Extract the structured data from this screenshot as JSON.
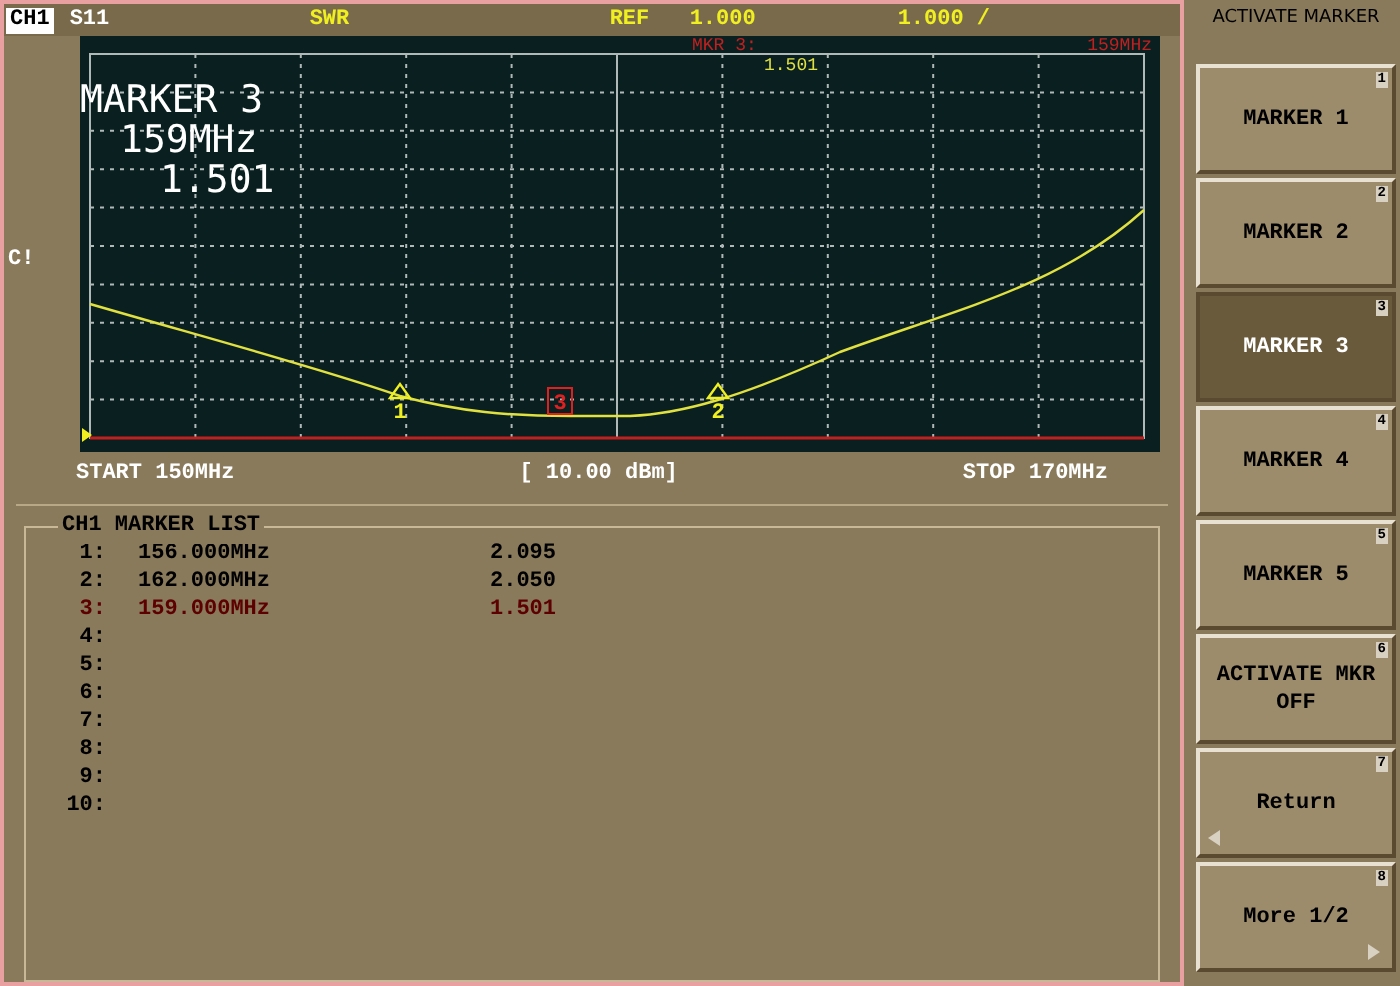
{
  "header": {
    "channel": "CH1",
    "parameter": "S11",
    "format": "SWR",
    "ref_label": "REF",
    "ref_value": "1.000",
    "scale": "1.000 /"
  },
  "side_label": "C!",
  "marker_readout": {
    "title": "MARKER 3",
    "frequency": "159MHz",
    "value": "1.501"
  },
  "active_marker_line": {
    "label": "MKR 3:",
    "value": "1.501",
    "frequency": "159MHz"
  },
  "markers": [
    {
      "label": "1",
      "selected": false
    },
    {
      "label": "3",
      "selected": true
    },
    {
      "label": "2",
      "selected": false
    }
  ],
  "footer": {
    "start": "START 150MHz",
    "power": "[ 10.00 dBm]",
    "stop": "STOP 170MHz"
  },
  "marker_list": {
    "title": "CH1 MARKER LIST",
    "rows": [
      {
        "index": "1:",
        "frequency": "156.000MHz",
        "value": "2.095",
        "selected": false
      },
      {
        "index": "2:",
        "frequency": "162.000MHz",
        "value": "2.050",
        "selected": false
      },
      {
        "index": "3:",
        "frequency": "159.000MHz",
        "value": "1.501",
        "selected": true
      },
      {
        "index": "4:",
        "selected": false
      },
      {
        "index": "5:",
        "selected": false
      },
      {
        "index": "6:",
        "selected": false
      },
      {
        "index": "7:",
        "selected": false
      },
      {
        "index": "8:",
        "selected": false
      },
      {
        "index": "9:",
        "selected": false
      },
      {
        "index": "10:",
        "selected": false
      }
    ]
  },
  "softkeys": {
    "title": "ACTIVATE MARKER",
    "keys": [
      {
        "label": "MARKER 1",
        "number": "1",
        "selected": false
      },
      {
        "label": "MARKER 2",
        "number": "2",
        "selected": false
      },
      {
        "label": "MARKER 3",
        "number": "3",
        "selected": true
      },
      {
        "label": "MARKER 4",
        "number": "4",
        "selected": false
      },
      {
        "label": "MARKER 5",
        "number": "5",
        "selected": false
      },
      {
        "label": "ACTIVATE MKR OFF",
        "number": "6",
        "selected": false
      },
      {
        "label": "Return",
        "number": "7",
        "selected": false,
        "kind": "back"
      },
      {
        "label": "More 1/2",
        "number": "8",
        "selected": false,
        "kind": "next"
      }
    ]
  }
}
